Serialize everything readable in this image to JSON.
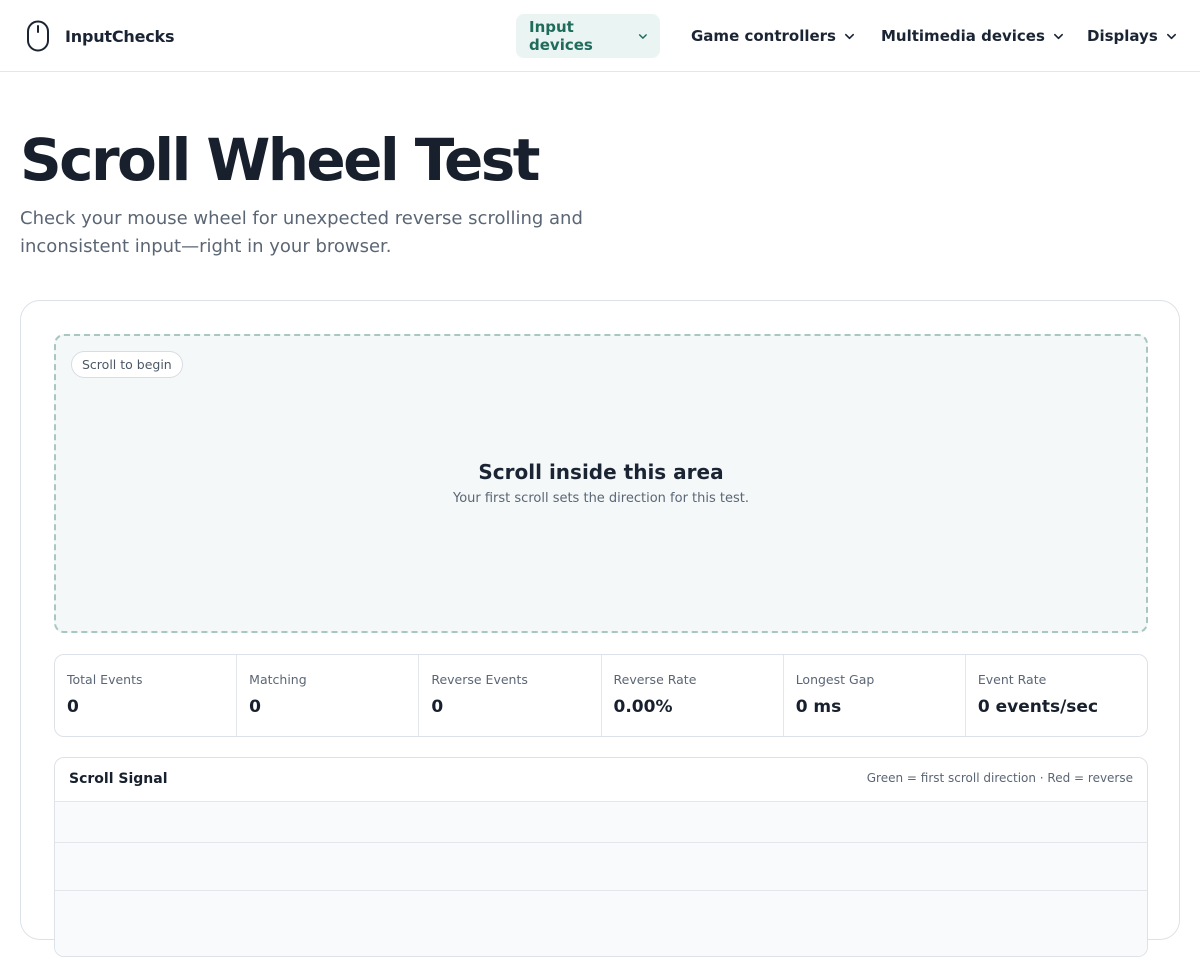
{
  "brand": {
    "name": "InputChecks",
    "icon": "mouse-icon"
  },
  "nav": [
    {
      "label": "Input devices",
      "active": true
    },
    {
      "label": "Game controllers",
      "active": false
    },
    {
      "label": "Multimedia devices",
      "active": false
    },
    {
      "label": "Displays",
      "active": false
    }
  ],
  "hero": {
    "title": "Scroll Wheel Test",
    "subtitle": "Check your mouse wheel for unexpected reverse scrolling and inconsistent input—right in your browser."
  },
  "scroll_area": {
    "status": "Scroll to begin",
    "title": "Scroll inside this area",
    "hint": "Your first scroll sets the direction for this test."
  },
  "stats": [
    {
      "label": "Total Events",
      "value": "0"
    },
    {
      "label": "Matching",
      "value": "0"
    },
    {
      "label": "Reverse Events",
      "value": "0"
    },
    {
      "label": "Reverse Rate",
      "value": "0.00%"
    },
    {
      "label": "Longest Gap",
      "value": "0 ms"
    },
    {
      "label": "Event Rate",
      "value": "0 events/sec"
    }
  ],
  "signal": {
    "title": "Scroll Signal",
    "legend": "Green = first scroll direction · Red = reverse"
  },
  "colors": {
    "accent": "#1f6b5c",
    "accent_bg": "#eaf4f2",
    "text": "#18202d",
    "muted": "#5b6675",
    "match": "#22a06b",
    "reverse": "#d64545"
  }
}
